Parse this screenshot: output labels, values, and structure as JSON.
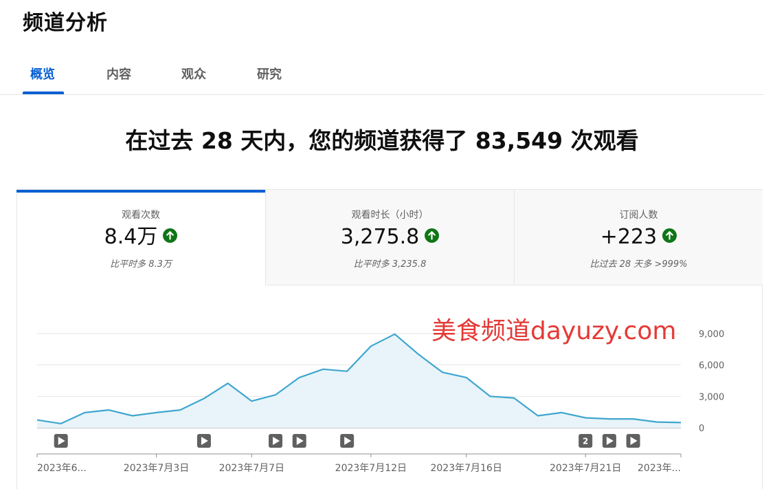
{
  "page_title": "频道分析",
  "tabs": [
    {
      "label": "概览",
      "active": true
    },
    {
      "label": "内容",
      "active": false
    },
    {
      "label": "观众",
      "active": false
    },
    {
      "label": "研究",
      "active": false
    }
  ],
  "headline": "在过去 28 天内，您的频道获得了 83,549 次观看",
  "metrics": [
    {
      "label": "观看次数",
      "value": "8.4万",
      "comparison": "比平时多 8.3万",
      "trend": "up",
      "icon": "arrow-up-icon"
    },
    {
      "label": "观看时长（小时）",
      "value": "3,275.8",
      "comparison": "比平时多 3,235.8",
      "trend": "up",
      "icon": "arrow-up-icon"
    },
    {
      "label": "订阅人数",
      "value": "+223",
      "comparison": "比过去 28 天多 >999%",
      "trend": "up",
      "icon": "arrow-up-icon"
    }
  ],
  "watermark": "美食频道dayuzy.com",
  "colors": {
    "accent": "#065fd4",
    "trend_up": "#107516",
    "line": "#3ea6cf",
    "area": "#e8f4f9",
    "watermark": "#e53935"
  },
  "chart_data": {
    "type": "area",
    "x": [
      "2023-06-29",
      "2023-06-30",
      "2023-07-01",
      "2023-07-02",
      "2023-07-03",
      "2023-07-04",
      "2023-07-05",
      "2023-07-06",
      "2023-07-07",
      "2023-07-08",
      "2023-07-09",
      "2023-07-10",
      "2023-07-11",
      "2023-07-12",
      "2023-07-13",
      "2023-07-14",
      "2023-07-15",
      "2023-07-16",
      "2023-07-17",
      "2023-07-18",
      "2023-07-19",
      "2023-07-20",
      "2023-07-21",
      "2023-07-22",
      "2023-07-23",
      "2023-07-24",
      "2023-07-25",
      "2023-07-26"
    ],
    "series": [
      {
        "values": [
          750,
          400,
          1450,
          1700,
          1150,
          1450,
          1700,
          2800,
          4250,
          2550,
          3150,
          4800,
          5600,
          5400,
          7800,
          8950,
          7000,
          5300,
          4800,
          3000,
          2850,
          1150,
          1450,
          950,
          850,
          850,
          550,
          500
        ]
      }
    ],
    "xtick_labels": [
      "2023年6...",
      "2023年7月3日",
      "2023年7月7日",
      "2023年7月12日",
      "2023年7月16日",
      "2023年7月21日",
      "2023年..."
    ],
    "xtick_indices": [
      0,
      5,
      9,
      14,
      18,
      23,
      27
    ],
    "yticks": [
      0,
      3000,
      6000,
      9000
    ],
    "ytick_labels": [
      "0",
      "3,000",
      "6,000",
      "9,000"
    ],
    "ylim": [
      0,
      10000
    ],
    "grid": true,
    "legend": "none",
    "markers": [
      {
        "index": 1,
        "label": "play"
      },
      {
        "index": 7,
        "label": "play"
      },
      {
        "index": 10,
        "label": "play"
      },
      {
        "index": 11,
        "label": "play"
      },
      {
        "index": 13,
        "label": "play"
      },
      {
        "index": 23,
        "label": "2"
      },
      {
        "index": 24,
        "label": "play"
      },
      {
        "index": 25,
        "label": "play"
      }
    ]
  }
}
